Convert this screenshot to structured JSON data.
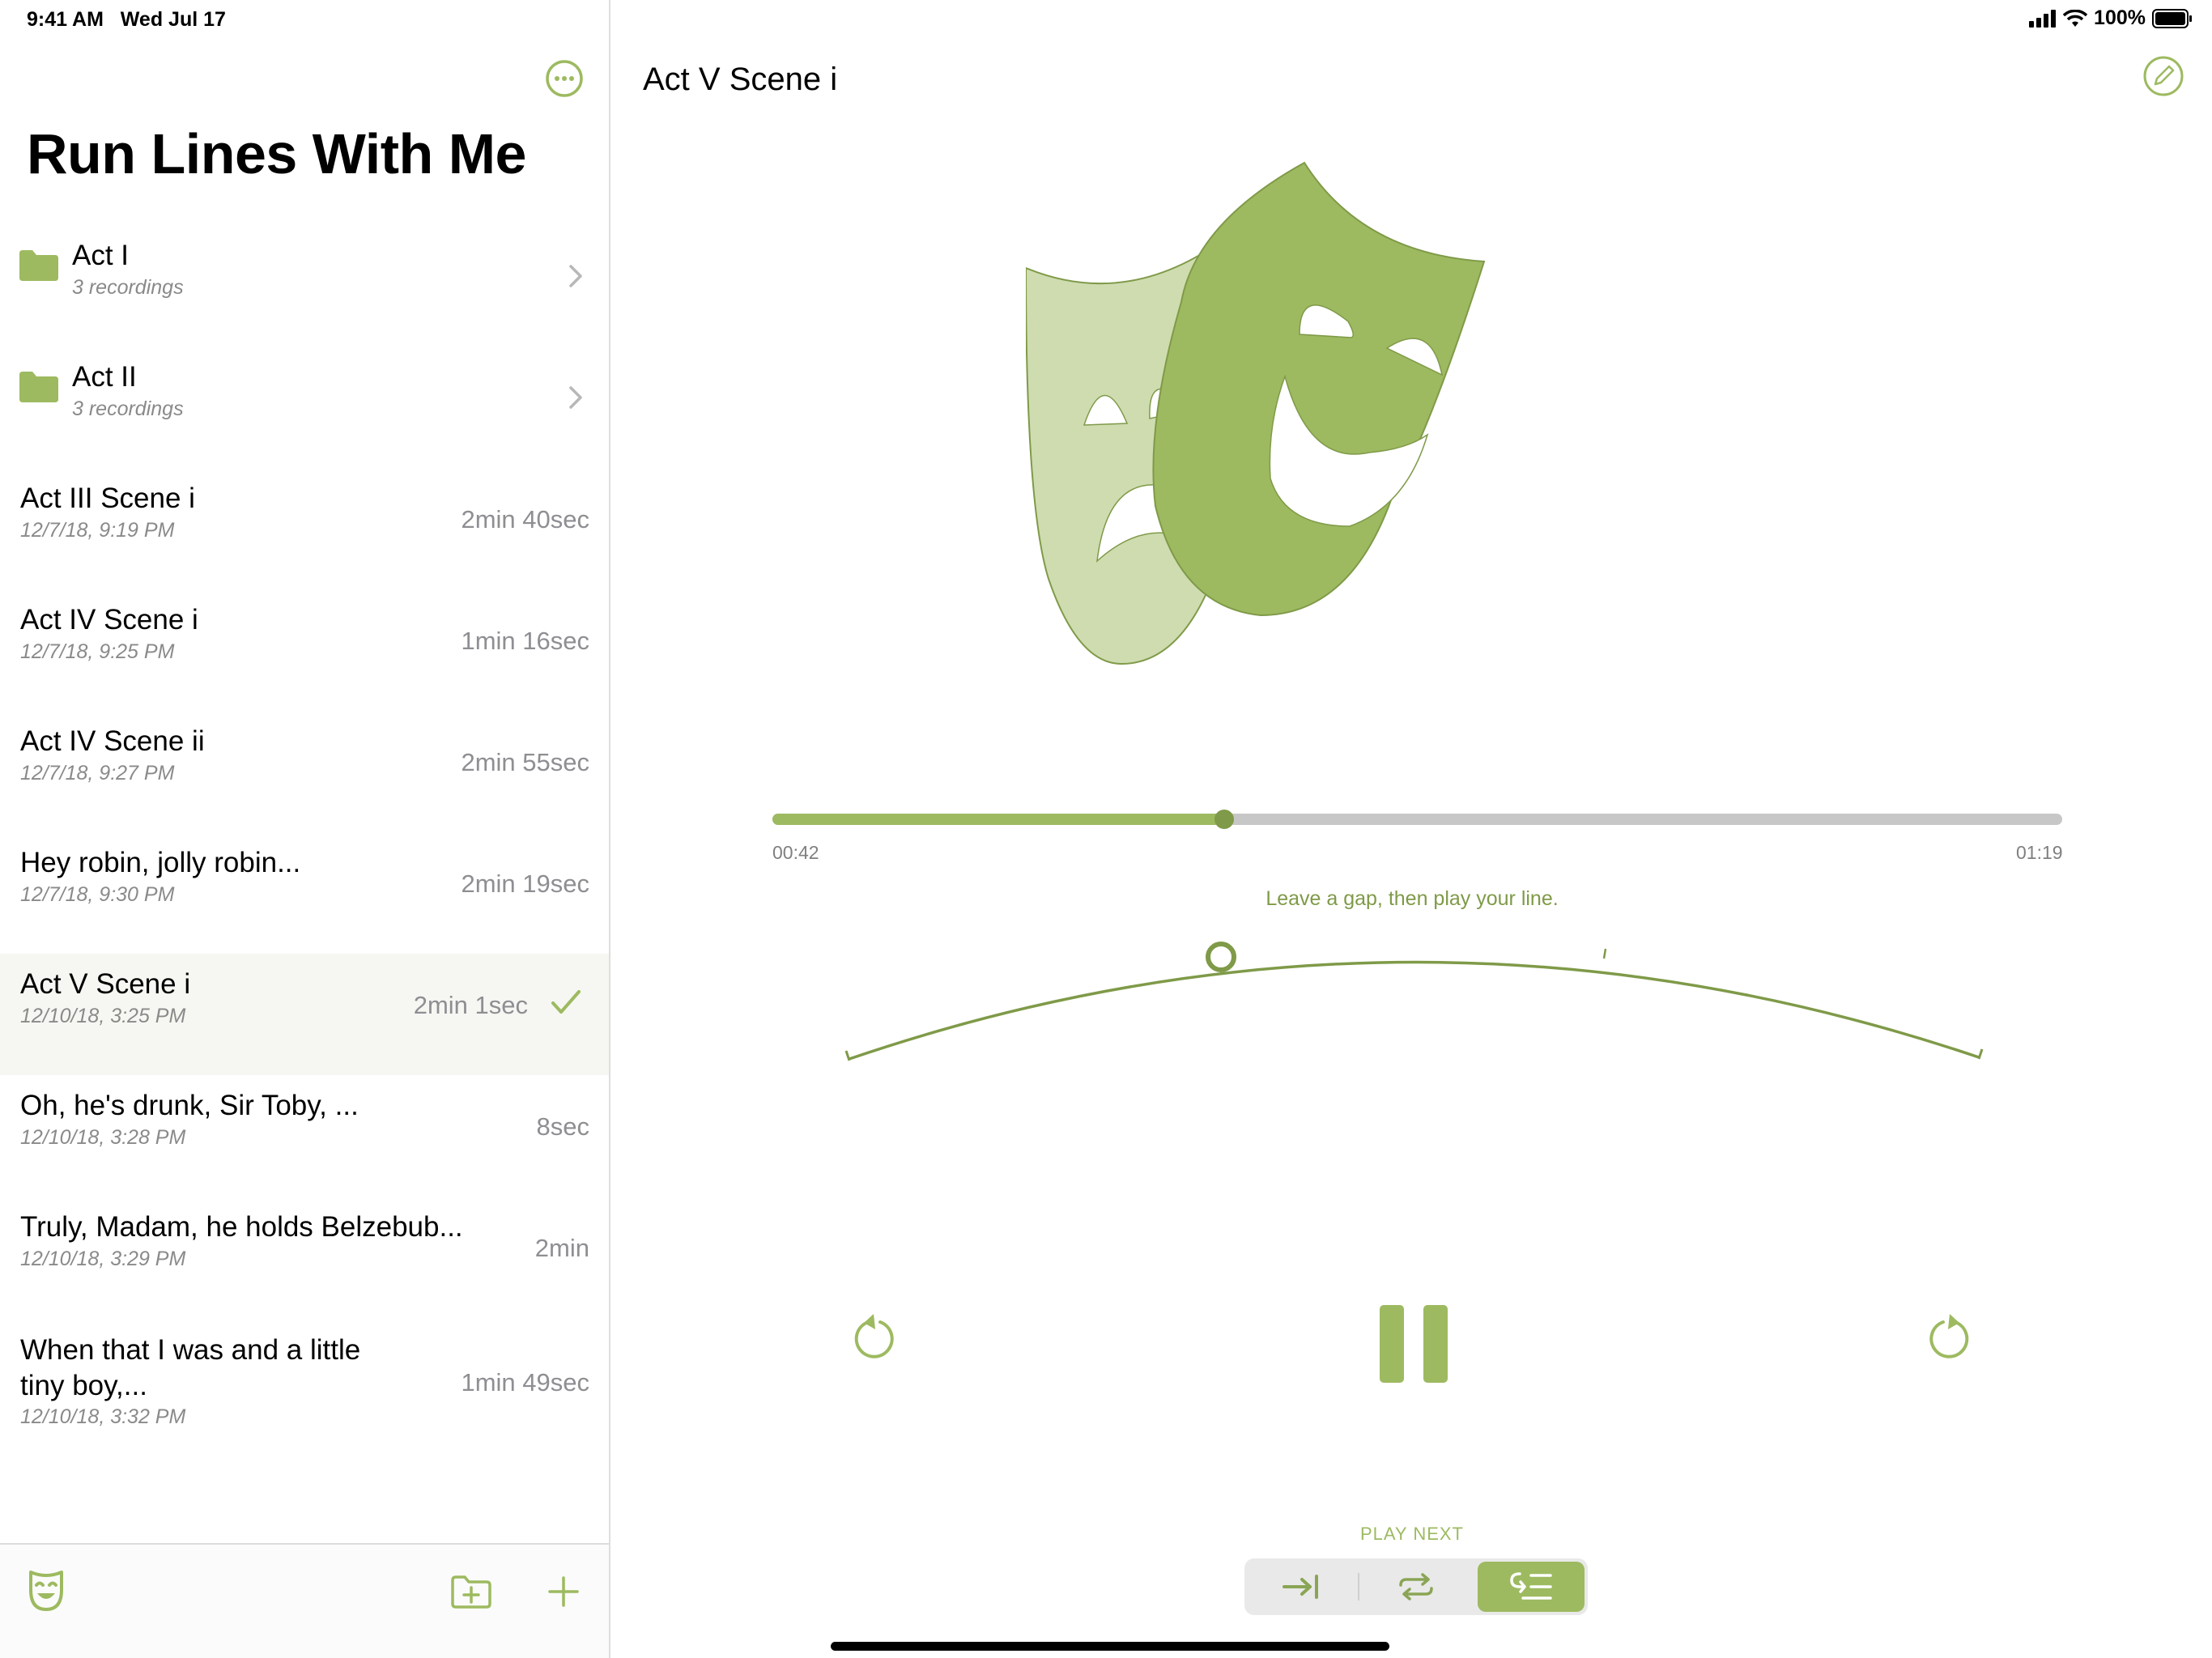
{
  "status_bar": {
    "time": "9:41 AM   Wed Jul 17",
    "battery": "100%"
  },
  "sidebar": {
    "title": "Run Lines With Me",
    "folders": [
      {
        "title": "Act I",
        "subtitle": "3 recordings"
      },
      {
        "title": "Act II",
        "subtitle": "3 recordings"
      }
    ],
    "recordings": [
      {
        "title": "Act III Scene i",
        "date": "12/7/18, 9:19 PM",
        "duration": "2min 40sec"
      },
      {
        "title": "Act IV Scene i",
        "date": "12/7/18, 9:25 PM",
        "duration": "1min 16sec"
      },
      {
        "title": "Act IV Scene ii",
        "date": "12/7/18, 9:27 PM",
        "duration": "2min 55sec"
      },
      {
        "title": "Hey robin, jolly robin...",
        "date": "12/7/18, 9:30 PM",
        "duration": "2min 19sec"
      },
      {
        "title": "Act V Scene i",
        "date": "12/10/18, 3:25 PM",
        "duration": "2min 1sec",
        "selected": true
      },
      {
        "title": "Oh, he's drunk, Sir Toby, ...",
        "date": "12/10/18, 3:28 PM",
        "duration": "8sec"
      },
      {
        "title": "Truly, Madam, he holds Belzebub...",
        "date": "12/10/18, 3:29 PM",
        "duration": "2min"
      },
      {
        "title": "When that I was and a little tiny boy,...",
        "date": "12/10/18, 3:32 PM",
        "duration": "1min 49sec"
      }
    ],
    "toolbar_icons": [
      "theater-mask-icon",
      "new-folder-icon",
      "plus-icon"
    ]
  },
  "detail": {
    "title": "Act V Scene i",
    "elapsed": "00:42",
    "total": "01:19",
    "progress": 0.35,
    "gap_hint": "Leave a gap, then play your line.",
    "play_next_label": "PLAY NEXT",
    "play_next_modes": [
      "skip-to-end-icon",
      "repeat-icon",
      "play-next-list-icon"
    ],
    "play_next_selected": 2
  },
  "colors": {
    "accent": "#9dba60",
    "accent_dark": "#7f9a48",
    "mask_light": "#cfdcb0"
  }
}
